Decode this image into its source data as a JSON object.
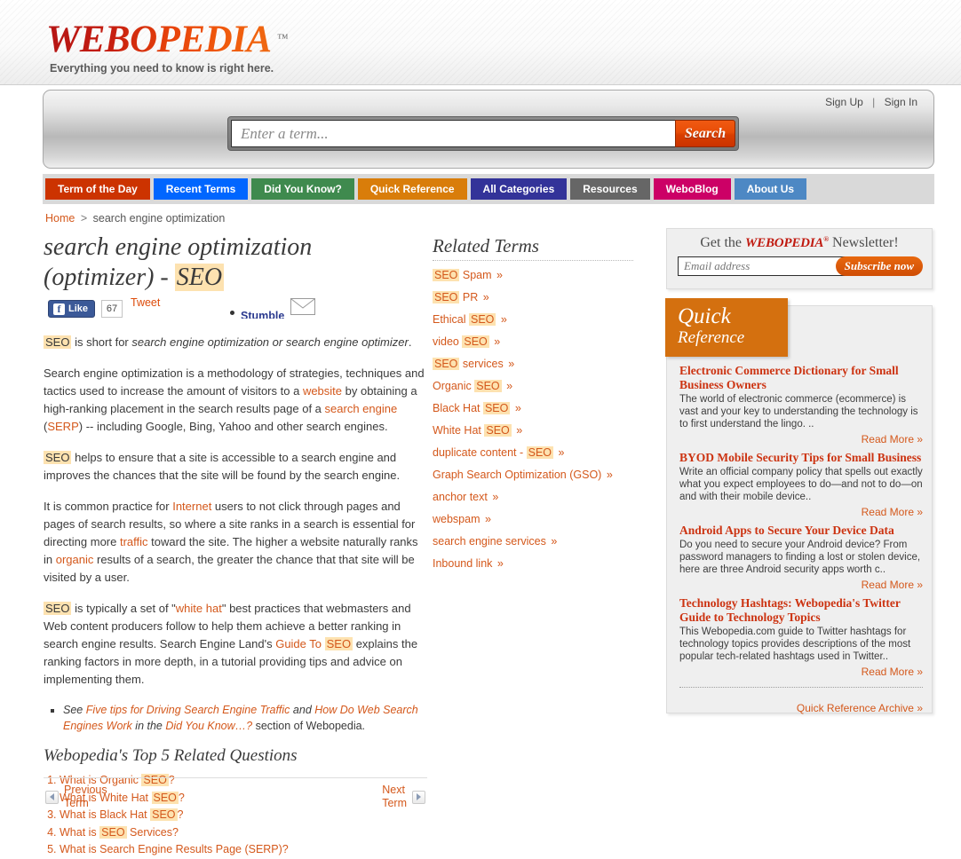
{
  "header": {
    "logo_text": "WEBOPEDIA",
    "logo_tm": "™",
    "tagline": "Everything you need to know is right here."
  },
  "account": {
    "sign_up": "Sign Up",
    "separator": "|",
    "sign_in": "Sign In"
  },
  "search": {
    "placeholder": "Enter a term...",
    "value": "",
    "button_label": "Search"
  },
  "nav": {
    "items": [
      {
        "label": "Term of the Day",
        "color": "#cc3300"
      },
      {
        "label": "Recent Terms",
        "color": "#0066ff"
      },
      {
        "label": "Did You Know?",
        "color": "#3f8a4e"
      },
      {
        "label": "Quick Reference",
        "color": "#d97d0a"
      },
      {
        "label": "All Categories",
        "color": "#333399"
      },
      {
        "label": "Resources",
        "color": "#666666"
      },
      {
        "label": "WeboBlog",
        "color": "#cc0066"
      },
      {
        "label": "About Us",
        "color": "#4d88c4"
      }
    ]
  },
  "breadcrumb": {
    "home": "Home",
    "separator": ">",
    "current": "search engine optimization"
  },
  "term": {
    "title_line1": "search engine optimization",
    "title_line2_prefix": "(optimizer) - ",
    "title_highlight": "SEO"
  },
  "social": {
    "fb_glyph": "f",
    "fb_label": "Like",
    "fb_count": "67",
    "tweet_label": "Tweet",
    "stumble_label": "Stumble",
    "mail_icon": "envelope-icon"
  },
  "body": {
    "lead_hl": "SEO",
    "lead_rest_a": " is short for ",
    "lead_italic": "search engine optimization or search engine optimizer",
    "lead_rest_b": ".",
    "p2_a": "Search engine optimization is a methodology of strategies, techniques and tactics used to increase the amount of visitors to a ",
    "p2_link1": "website",
    "p2_b": " by obtaining a high-ranking placement in the search results page of a ",
    "p2_link2": "search engine",
    "p2_c": " (",
    "p2_link3": "SERP",
    "p2_d": ") -- including Google, Bing, Yahoo and other search engines.",
    "p3_hl": "SEO",
    "p3_rest": " helps to ensure that a site is accessible to a search engine and improves the chances that the site will be found by the search engine.",
    "p4_a": "It is common practice for ",
    "p4_link1": "Internet",
    "p4_b": " users to not click through pages and pages of search results, so where a site ranks in a search is essential for directing more ",
    "p4_link2": "traffic",
    "p4_c": " toward the site. The higher a website naturally ranks in ",
    "p4_link3": "organic",
    "p4_d": " results of a search, the greater the chance that that site will be visited by a user.",
    "p5_hl": "SEO",
    "p5_a": " is typically a set of \"",
    "p5_link1": "white hat",
    "p5_b": "\" best practices that webmasters and Web content producers follow to help them achieve a better ranking in search engine results. Search Engine Land's ",
    "p5_link2_a": "Guide To ",
    "p5_link2_hl": "SEO",
    "p5_c": " explains the ranking factors in more depth, in a tutorial providing tips and advice on implementing them.",
    "note_see": "See ",
    "note_link1": "Five tips for Driving Search Engine Traffic",
    "note_and": " and ",
    "note_link2": "How Do Web Search Engines Work",
    "note_in": " in the ",
    "note_link3": "Did You Know…?",
    "note_tail": " section of Webopedia."
  },
  "top5": {
    "heading": "Webopedia's Top 5 Related Questions",
    "items": [
      {
        "pre": "What is Organic ",
        "hl": "SEO",
        "post": "?"
      },
      {
        "pre": "What is White Hat ",
        "hl": "SEO",
        "post": "?"
      },
      {
        "pre": "What is Black Hat ",
        "hl": "SEO",
        "post": "?"
      },
      {
        "pre": "What is ",
        "hl": "SEO",
        "post": " Services?"
      },
      {
        "pre": "What is Search Engine Results Page (SERP)?",
        "hl": "",
        "post": ""
      }
    ]
  },
  "pager": {
    "prev_line1": "Previous",
    "prev_line2": "Term",
    "next_line1": "Next",
    "next_line2": "Term"
  },
  "related": {
    "heading": "Related Terms",
    "chevron": "»",
    "items": [
      {
        "pre": "",
        "hl": "SEO",
        "post": " Spam"
      },
      {
        "pre": "",
        "hl": "SEO",
        "post": " PR"
      },
      {
        "pre": "Ethical ",
        "hl": "SEO",
        "post": ""
      },
      {
        "pre": "video ",
        "hl": "SEO",
        "post": ""
      },
      {
        "pre": "",
        "hl": "SEO",
        "post": " services"
      },
      {
        "pre": "Organic ",
        "hl": "SEO",
        "post": ""
      },
      {
        "pre": "Black Hat ",
        "hl": "SEO",
        "post": ""
      },
      {
        "pre": "White Hat ",
        "hl": "SEO",
        "post": ""
      },
      {
        "pre": "duplicate content - ",
        "hl": "SEO",
        "post": ""
      },
      {
        "pre": "Graph Search Optimization (GSO)",
        "hl": "",
        "post": ""
      },
      {
        "pre": "anchor text",
        "hl": "",
        "post": ""
      },
      {
        "pre": "webspam",
        "hl": "",
        "post": ""
      },
      {
        "pre": "search engine services",
        "hl": "",
        "post": ""
      },
      {
        "pre": "Inbound link",
        "hl": "",
        "post": ""
      }
    ]
  },
  "newsletter": {
    "title_pre": "Get the ",
    "title_brand": "WEBOPEDIA",
    "title_tm": "®",
    "title_post": " Newsletter!",
    "email_placeholder": "Email address",
    "email_value": "",
    "subscribe_label": "Subscribe now"
  },
  "quick_reference": {
    "tab_line1": "Quick",
    "tab_line2": "Reference",
    "read_more": "Read More »",
    "archive": "Quick Reference Archive »",
    "items": [
      {
        "title": "Electronic Commerce Dictionary for Small Business Owners",
        "desc": "The world of electronic commerce (ecommerce) is vast and your key to understanding the technology is to first understand the lingo. .."
      },
      {
        "title": "BYOD Mobile Security Tips for Small Business",
        "desc": "Write an official company policy that spells out exactly what you expect employees to do—and not to do—on and with their mobile device.."
      },
      {
        "title": "Android Apps to Secure Your Device Data",
        "desc": "Do you need to secure your Android device? From password managers to finding a lost or stolen device, here are three Android security apps worth c.."
      },
      {
        "title": "Technology Hashtags: Webopedia's Twitter Guide to Technology Topics",
        "desc": "This Webopedia.com guide to Twitter hashtags for technology topics provides descriptions of the most popular tech-related hashtags used in Twitter.."
      }
    ]
  }
}
